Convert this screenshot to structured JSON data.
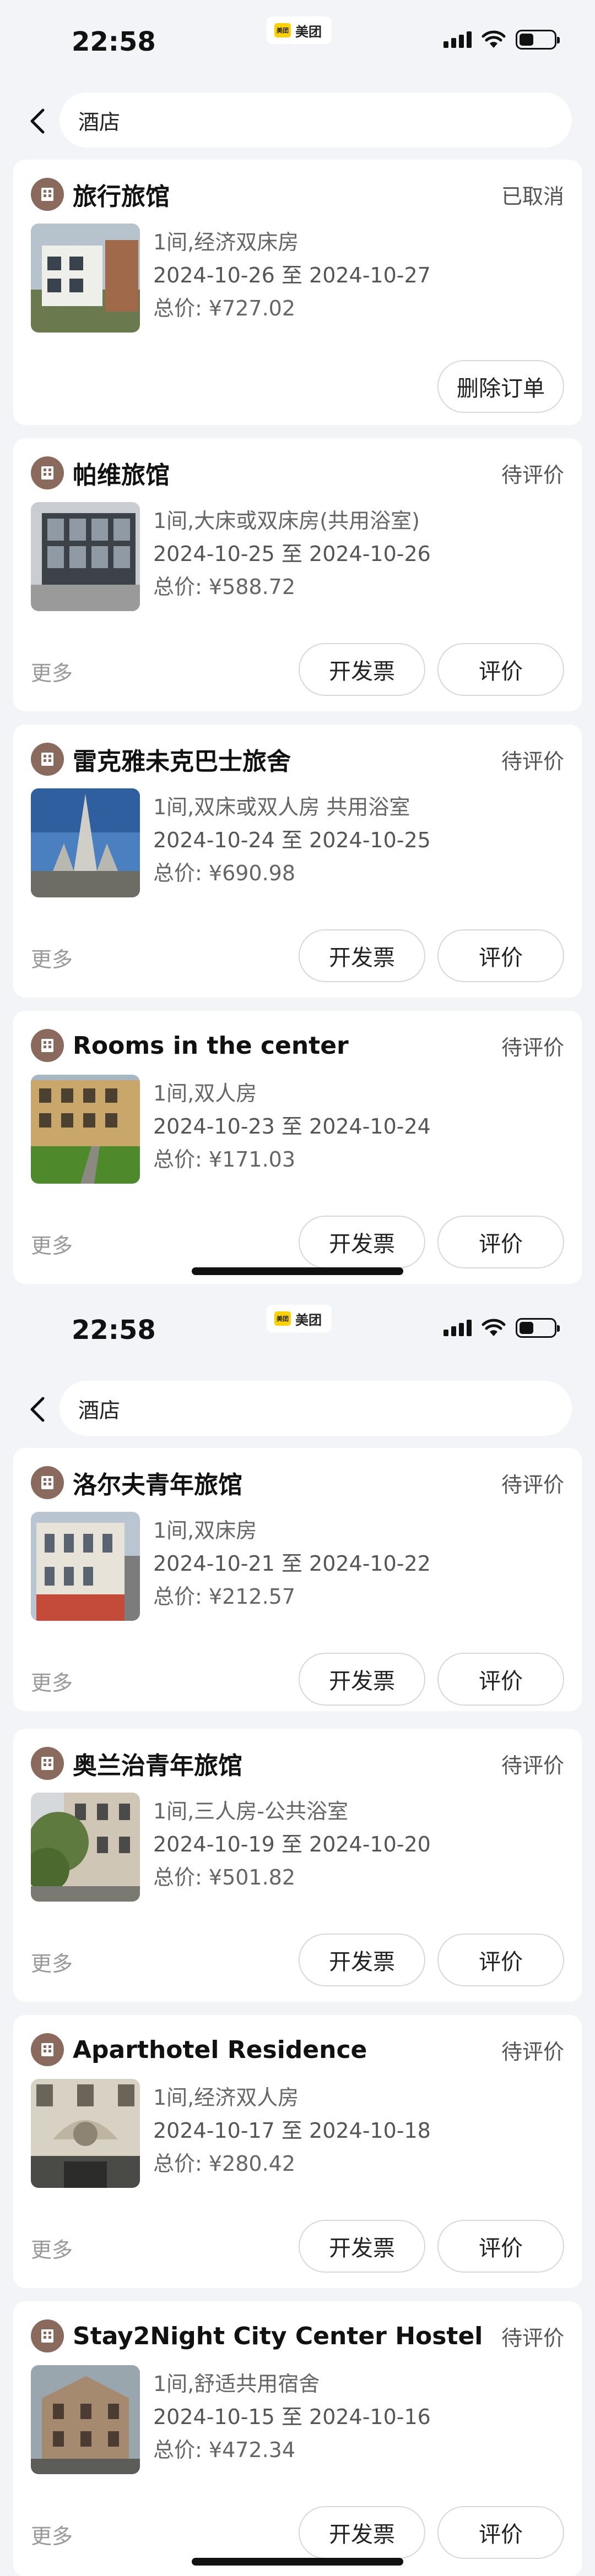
{
  "status_bar": {
    "time": "22:58",
    "app_badge": "美团",
    "app_badge_logo": "美团"
  },
  "header": {
    "back_icon": "chevron-left-icon",
    "search_text": "酒店"
  },
  "labels": {
    "more": "更多",
    "invoice_button": "开发票",
    "review_button": "评价",
    "delete_button": "删除订单",
    "price_prefix": "总价: ",
    "date_separator": " 至 "
  },
  "screen1": {
    "orders": [
      {
        "name": "旅行旅馆",
        "status": "已取消",
        "room": "1间,经济双床房",
        "checkin": "2024-10-26",
        "checkout": "2024-10-27",
        "price": "¥727.02",
        "actions": "delete"
      },
      {
        "name": "帕维旅馆",
        "status": "待评价",
        "room": "1间,大床或双床房(共用浴室)",
        "checkin": "2024-10-25",
        "checkout": "2024-10-26",
        "price": "¥588.72",
        "actions": "review"
      },
      {
        "name": "雷克雅未克巴士旅舍",
        "status": "待评价",
        "room": "1间,双床或双人房 共用浴室",
        "checkin": "2024-10-24",
        "checkout": "2024-10-25",
        "price": "¥690.98",
        "actions": "review"
      },
      {
        "name": "Rooms in the center",
        "status": "待评价",
        "room": "1间,双人房",
        "checkin": "2024-10-23",
        "checkout": "2024-10-24",
        "price": "¥171.03",
        "actions": "review"
      }
    ]
  },
  "screen2": {
    "orders": [
      {
        "name": "洛尔夫青年旅馆",
        "status": "待评价",
        "room": "1间,双床房",
        "checkin": "2024-10-21",
        "checkout": "2024-10-22",
        "price": "¥212.57",
        "actions": "review"
      },
      {
        "name": "奥兰治青年旅馆",
        "status": "待评价",
        "room": "1间,三人房-公共浴室",
        "checkin": "2024-10-19",
        "checkout": "2024-10-20",
        "price": "¥501.82",
        "actions": "review"
      },
      {
        "name": "Aparthotel Residence",
        "status": "待评价",
        "room": "1间,经济双人房",
        "checkin": "2024-10-17",
        "checkout": "2024-10-18",
        "price": "¥280.42",
        "actions": "review"
      },
      {
        "name": "Stay2Night City Center Hostel",
        "status": "待评价",
        "room": "1间,舒适共用宿舍",
        "checkin": "2024-10-15",
        "checkout": "2024-10-16",
        "price": "¥472.34",
        "actions": "review"
      }
    ]
  },
  "colors": {
    "background": "#f3f4f8",
    "card": "#ffffff",
    "hotel_icon": "#8b6a5e",
    "text": "#222222",
    "muted": "#999999"
  }
}
